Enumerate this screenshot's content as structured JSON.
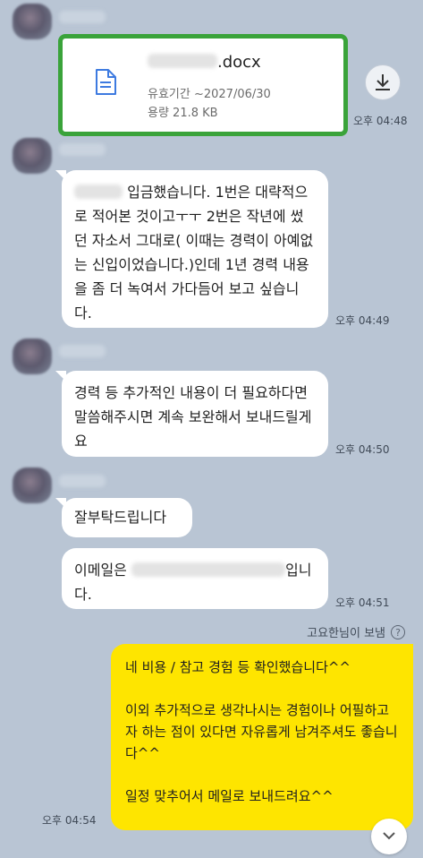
{
  "messages": [
    {
      "type": "file",
      "file_name_suffix": ".docx",
      "expiry": "유효기간 ~2027/06/30",
      "size": "용량 21.8 KB",
      "time": "오후 04:48"
    },
    {
      "type": "text",
      "text_prefix_redacted": true,
      "text": "입금했습니다. 1번은 대략적으로 적어본 것이고ㅜㅜ 2번은 작년에 썼던 자소서 그대로( 이때는 경력이 아예없는 신입이었습니다.)인데 1년 경력 내용을 좀 더 녹여서 가다듬어 보고 싶습니다.",
      "time": "오후 04:49"
    },
    {
      "type": "text",
      "text": "경력 등 추가적인 내용이 더 필요하다면 말씀해주시면 계속 보완해서 보내드릴게요",
      "time": "오후 04:50"
    },
    {
      "type": "text_group",
      "bubbles": [
        {
          "text": "잘부탁드립니다"
        },
        {
          "text_before": "이메일은",
          "text_after": "입니다."
        }
      ],
      "time": "오후 04:51"
    }
  ],
  "sent_by": "고요한님이 보냄",
  "my_message": {
    "lines": [
      "네 비용 / 참고 경험 등 확인했습니다^^",
      "",
      "이외 추가적으로 생각나시는 경험이나 어필하고자 하는 점이 있다면 자유롭게 남겨주셔도 좋습니다^^",
      "",
      "일정 맞추어서 메일로 보내드려요^^"
    ],
    "time": "오후 04:54"
  },
  "icons": {
    "file": "document-icon",
    "download": "download-icon",
    "help": "help-circle-icon",
    "scroll": "scroll-down-icon"
  },
  "colors": {
    "background": "#b9c5d4",
    "my_bubble": "#fee500",
    "highlight_border": "#3aa33a"
  }
}
